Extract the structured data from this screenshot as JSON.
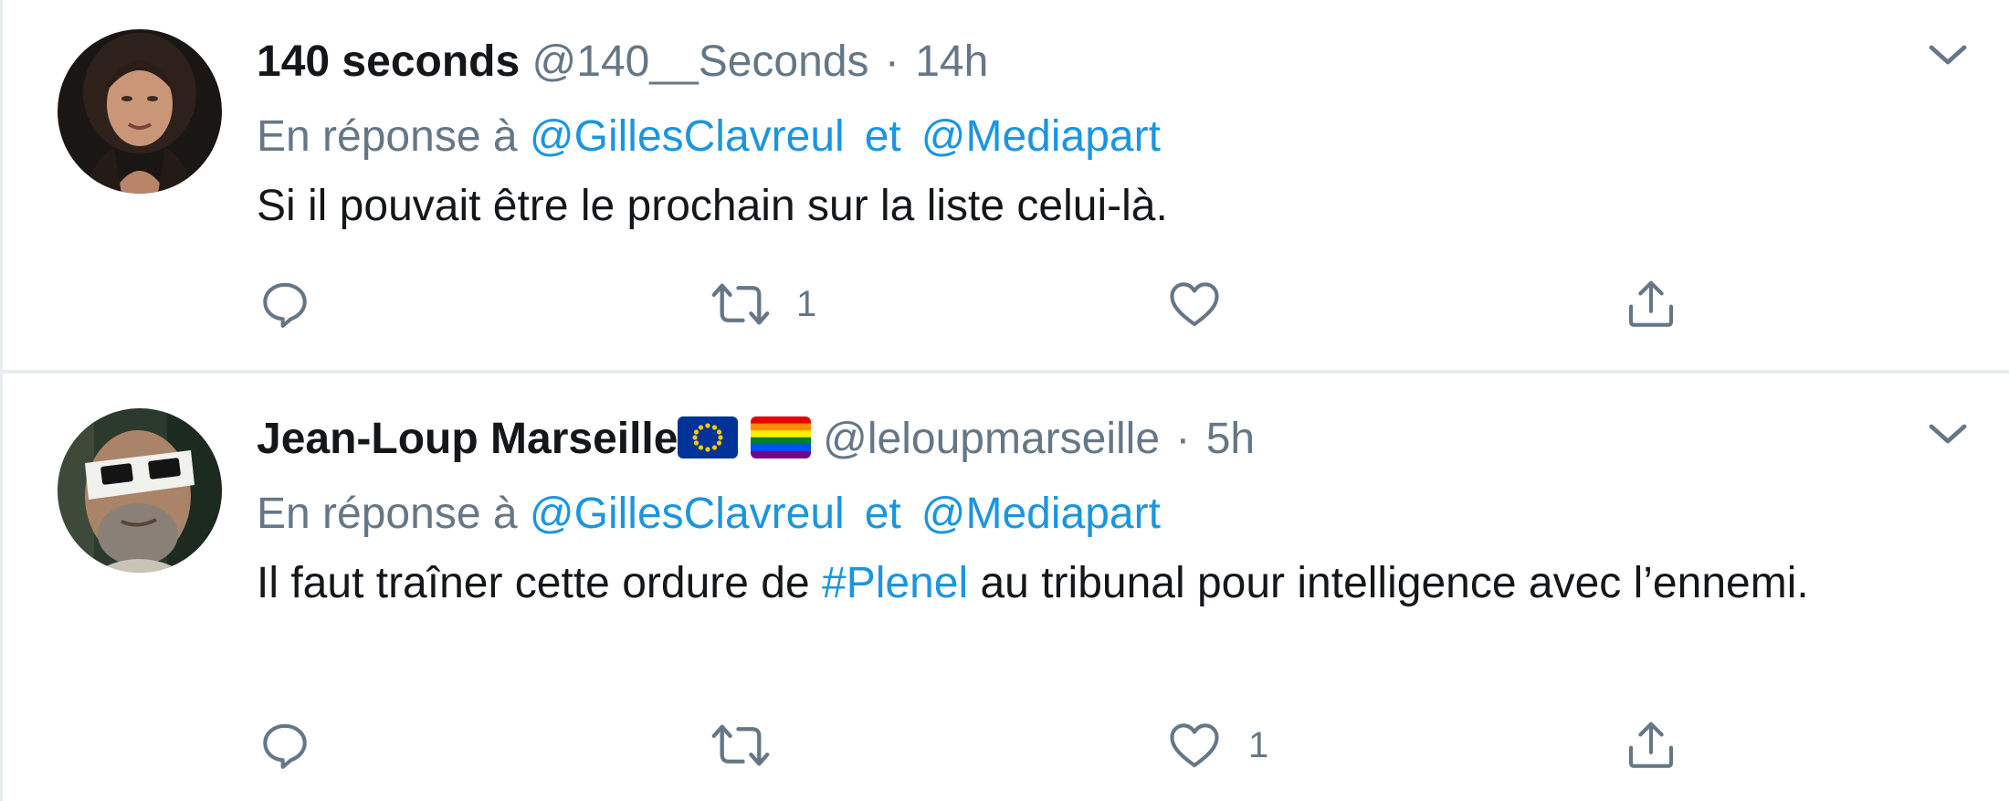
{
  "tweets": [
    {
      "display_name": "140 seconds",
      "handle": "@140__Seconds",
      "separator": "·",
      "time": "14h",
      "reply_prefix": "En réponse à",
      "mention_1": "@GillesClavreul",
      "conjunction": "et",
      "mention_2": "@Mediapart",
      "text": "Si il pouvait être le prochain sur la liste celui-là.",
      "reply_count": "",
      "retweet_count": "1",
      "like_count": "",
      "avatar": "woman-portrait-avatar"
    },
    {
      "display_name": "Jean-Loup Marseille",
      "flags": [
        "eu-flag",
        "rainbow-flag"
      ],
      "handle": "@leloupmarseille",
      "separator": "·",
      "time": "5h",
      "reply_prefix": "En réponse à",
      "mention_1": "@GillesClavreul",
      "conjunction": "et",
      "mention_2": "@Mediapart",
      "text_before": "Il faut traîner cette ordure de ",
      "hashtag": "#Plenel",
      "text_after": " au tribunal pour intelligence avec l’ennemi.",
      "reply_count": "",
      "retweet_count": "",
      "like_count": "1",
      "avatar": "man-with-eclipse-glasses-avatar"
    }
  ],
  "icons": [
    "reply-icon",
    "retweet-icon",
    "like-icon",
    "share-icon",
    "chevron-down-icon"
  ],
  "colors": {
    "link": "#1b95e0",
    "muted": "#657786",
    "text": "#14171a",
    "border": "#e6ecf0"
  }
}
